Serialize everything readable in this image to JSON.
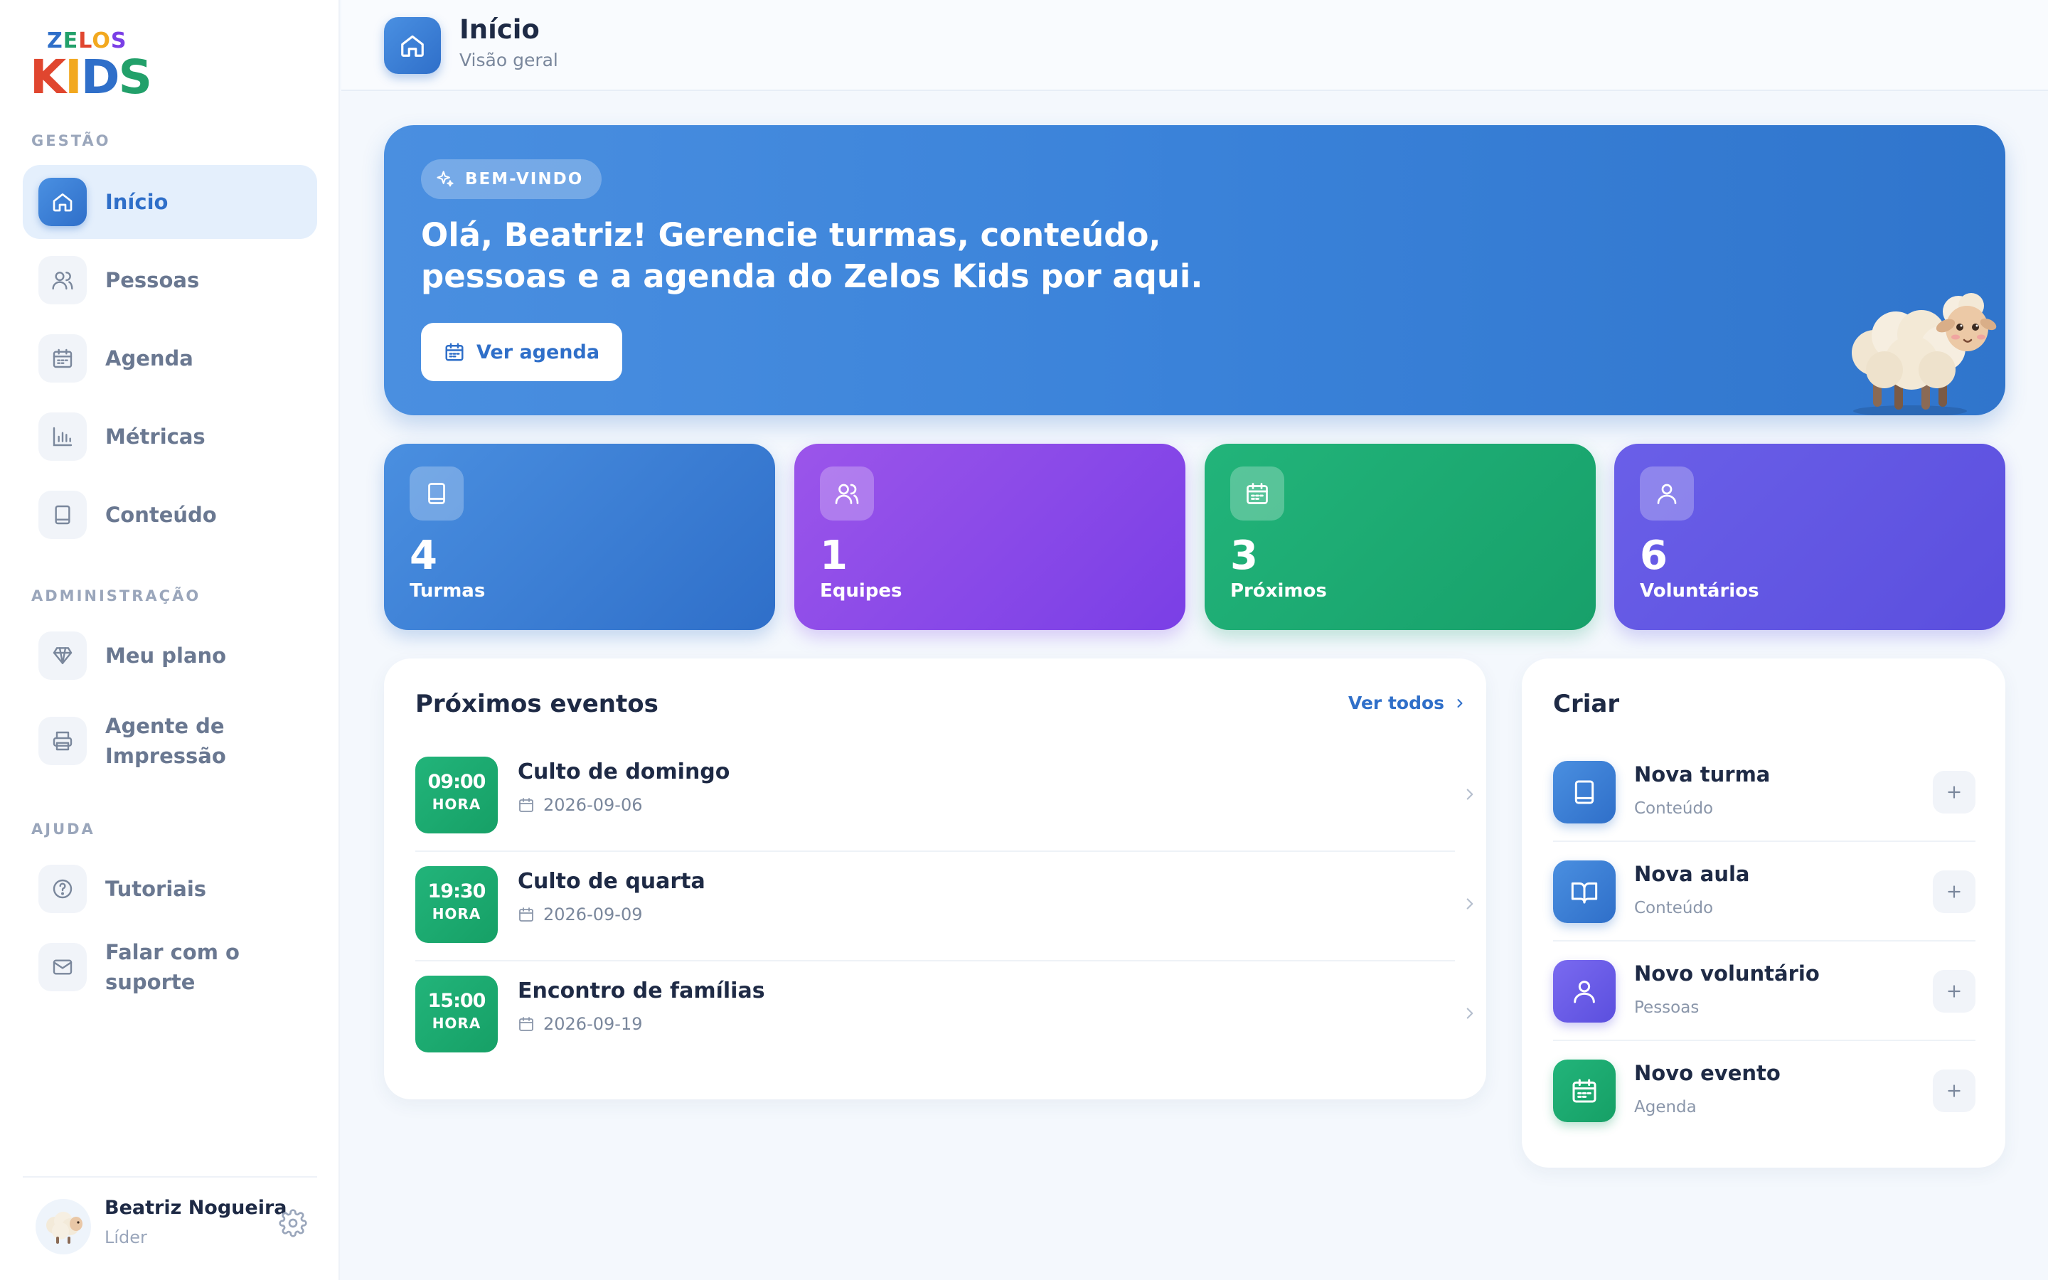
{
  "app": {
    "logo_line1": "ZELOS",
    "logo_line2": "KIDS",
    "colors": {
      "primary": "#2f6fc9",
      "purple": "#7a3fe6",
      "green": "#17a06a",
      "indigo": "#5b4fde"
    }
  },
  "sidebar": {
    "sections": {
      "gestao": "GESTÃO",
      "administracao": "ADMINISTRAÇÃO",
      "ajuda": "AJUDA"
    },
    "items": [
      {
        "label": "Início",
        "icon": "home-icon",
        "active": true
      },
      {
        "label": "Pessoas",
        "icon": "users-icon"
      },
      {
        "label": "Agenda",
        "icon": "calendar-icon"
      },
      {
        "label": "Métricas",
        "icon": "bar-chart-icon"
      },
      {
        "label": "Conteúdo",
        "icon": "book-icon"
      },
      {
        "label": "Meu plano",
        "icon": "diamond-icon"
      },
      {
        "label": "Agente de Impressão",
        "icon": "printer-icon"
      },
      {
        "label": "Tutoriais",
        "icon": "help-circle-icon"
      },
      {
        "label": "Falar com o suporte",
        "icon": "mail-icon"
      }
    ],
    "user": {
      "name": "Beatriz Nogueira",
      "role": "Líder",
      "avatar": "sheep-avatar"
    }
  },
  "header": {
    "title": "Início",
    "subtitle": "Visão geral",
    "icon": "home-icon"
  },
  "hero": {
    "badge": "BEM-VINDO",
    "title": "Olá, Beatriz! Gerencie turmas, conteúdo, pessoas e a agenda do Zelos Kids por aqui.",
    "button_label": "Ver agenda",
    "illustration": "sheep-illustration"
  },
  "stats": [
    {
      "value": "4",
      "label": "Turmas",
      "icon": "book-icon"
    },
    {
      "value": "1",
      "label": "Equipes",
      "icon": "users-icon"
    },
    {
      "value": "3",
      "label": "Próximos",
      "icon": "calendar-icon"
    },
    {
      "value": "6",
      "label": "Voluntários",
      "icon": "user-icon"
    }
  ],
  "events": {
    "title": "Próximos eventos",
    "see_all": "Ver todos",
    "items": [
      {
        "time": "09:00",
        "time_label": "HORA",
        "name": "Culto de domingo",
        "date": "2026-09-06"
      },
      {
        "time": "19:30",
        "time_label": "HORA",
        "name": "Culto de quarta",
        "date": "2026-09-09"
      },
      {
        "time": "15:00",
        "time_label": "HORA",
        "name": "Encontro de famílias",
        "date": "2026-09-19"
      }
    ]
  },
  "create": {
    "title": "Criar",
    "items": [
      {
        "title": "Nova turma",
        "subtitle": "Conteúdo",
        "icon": "book-icon"
      },
      {
        "title": "Nova aula",
        "subtitle": "Conteúdo",
        "icon": "open-book-icon"
      },
      {
        "title": "Novo voluntário",
        "subtitle": "Pessoas",
        "icon": "user-icon"
      },
      {
        "title": "Novo evento",
        "subtitle": "Agenda",
        "icon": "calendar-icon"
      }
    ]
  }
}
